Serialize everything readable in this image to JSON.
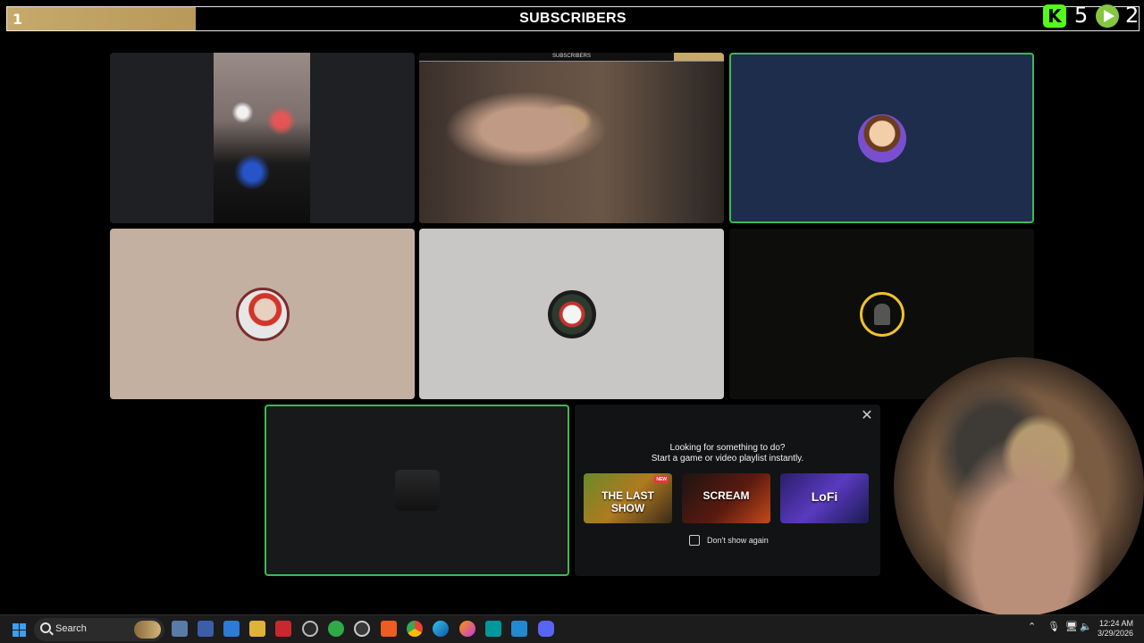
{
  "overlay": {
    "subscribers_title": "SUBSCRIBERS",
    "goal_count": "1",
    "kick_count": "5",
    "rumble_count": "2",
    "kick_icon_letter": "K"
  },
  "tiles": [
    {
      "name": "video-tile-1",
      "type": "camera"
    },
    {
      "name": "video-tile-2",
      "type": "camera",
      "mini_title": "SUBSCRIBERS"
    },
    {
      "name": "video-tile-3",
      "type": "avatar",
      "icon": "austin-avatar",
      "speaking": true
    },
    {
      "name": "video-tile-4",
      "type": "avatar",
      "icon": "mario-avatar"
    },
    {
      "name": "video-tile-5",
      "type": "avatar",
      "icon": "joker-avatar"
    },
    {
      "name": "video-tile-6",
      "type": "avatar",
      "icon": "gold-badge-avatar"
    },
    {
      "name": "video-tile-7",
      "type": "avatar",
      "icon": "dark-avatar",
      "speaking": true
    }
  ],
  "activity_promo": {
    "headline_line1": "Looking for something to do?",
    "headline_line2": "Start a game or video playlist instantly.",
    "cards": [
      {
        "label": "THE LAST SHOW",
        "badge": "NEW"
      },
      {
        "label": "SCREAM",
        "badge": ""
      },
      {
        "label": "LoFi",
        "badge": ""
      }
    ],
    "checkbox_label": "Don't show again",
    "checkbox_checked": false
  },
  "taskbar": {
    "search_placeholder": "Search",
    "time": "12:24 AM",
    "date": "3/29/2026"
  },
  "colors": {
    "speaking_border": "#3fb950",
    "tile_blue": "#1f2d4c",
    "goal_fill": "#c7a96c",
    "kick_green": "#53fc18",
    "rumble_green": "#85c742"
  }
}
